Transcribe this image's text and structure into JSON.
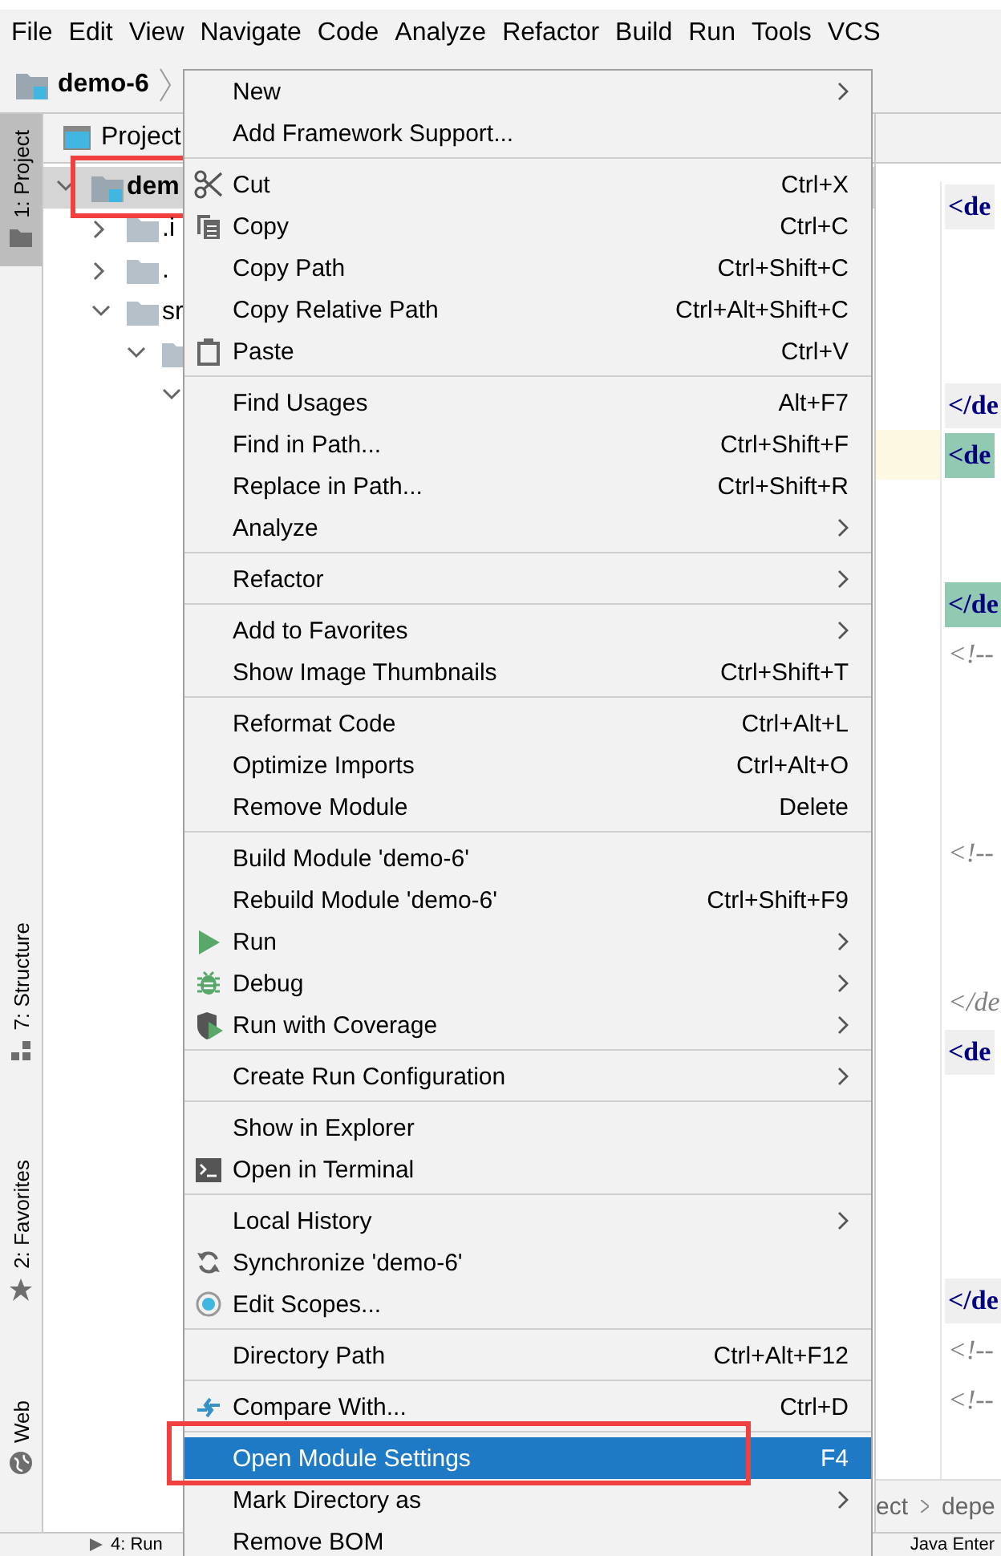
{
  "menubar": [
    "File",
    "Edit",
    "View",
    "Navigate",
    "Code",
    "Analyze",
    "Refactor",
    "Build",
    "Run",
    "Tools",
    "VCS"
  ],
  "breadcrumb": {
    "label": "demo-6"
  },
  "tool_strip": [
    {
      "label": "1: Project",
      "selected": true
    },
    {
      "label": "7: Structure",
      "selected": false
    },
    {
      "label": "2: Favorites",
      "selected": false
    },
    {
      "label": "Web",
      "selected": false
    }
  ],
  "project_panel": {
    "title": "Project",
    "tree": [
      {
        "label": "dem",
        "kind": "module",
        "expanded": true,
        "selected": true,
        "annotated": true,
        "children": [
          {
            "label": ".i",
            "kind": "folder",
            "expanded": false,
            "selected": false,
            "annotated": false
          },
          {
            "label": ".",
            "kind": "folder",
            "expanded": false,
            "selected": false,
            "annotated": false
          },
          {
            "label": "sr",
            "kind": "folder",
            "expanded": true,
            "selected": false,
            "annotated": false,
            "children": [
              {
                "kind": "folder",
                "expanded": true,
                "selected": false,
                "annotated": false,
                "children": [
                  {
                    "expanded": true,
                    "selected": false,
                    "annotated": false
                  }
                ]
              }
            ]
          }
        ]
      }
    ]
  },
  "editor": {
    "lines": [
      {
        "kind": "tag",
        "text": "<de",
        "color": "#efefef"
      },
      {
        "kind": "blank"
      },
      {
        "kind": "blank"
      },
      {
        "kind": "blank"
      },
      {
        "kind": "tag",
        "text": "</de",
        "color": "#efefef"
      },
      {
        "kind": "tag",
        "text": "<de",
        "color": "#92c9b3"
      },
      {
        "kind": "blank"
      },
      {
        "kind": "blank"
      },
      {
        "kind": "tag",
        "text": "</de",
        "color": "#92c9b3"
      },
      {
        "kind": "comment",
        "text": "<!--"
      },
      {
        "kind": "blank"
      },
      {
        "kind": "blank"
      },
      {
        "kind": "blank"
      },
      {
        "kind": "comment",
        "text": "<!--"
      },
      {
        "kind": "blank"
      },
      {
        "kind": "blank"
      },
      {
        "kind": "comment",
        "text": "</de"
      },
      {
        "kind": "tag",
        "text": "<de",
        "color": "#efefef"
      },
      {
        "kind": "blank"
      },
      {
        "kind": "blank"
      },
      {
        "kind": "blank"
      },
      {
        "kind": "blank"
      },
      {
        "kind": "tag",
        "text": "</de",
        "color": "#efefef"
      },
      {
        "kind": "comment",
        "text": "<!--"
      },
      {
        "kind": "comment",
        "text": "<!--"
      }
    ],
    "breadcrumb": [
      "ect",
      "depe"
    ]
  },
  "bottom_bar": {
    "run_tab": "4: Run",
    "right_tab": "Java Enter"
  },
  "context_menu": {
    "groups": [
      [
        {
          "label": "New",
          "submenu": true,
          "selected": false
        },
        {
          "label": "Add Framework Support...",
          "selected": false
        }
      ],
      [
        {
          "label": "Cut",
          "shortcut": "Ctrl+X",
          "kind": "scissors",
          "selected": false
        },
        {
          "label": "Copy",
          "shortcut": "Ctrl+C",
          "kind": "copy",
          "selected": false
        },
        {
          "label": "Copy Path",
          "shortcut": "Ctrl+Shift+C",
          "selected": false
        },
        {
          "label": "Copy Relative Path",
          "shortcut": "Ctrl+Alt+Shift+C",
          "selected": false
        },
        {
          "label": "Paste",
          "shortcut": "Ctrl+V",
          "kind": "clipboard",
          "selected": false
        }
      ],
      [
        {
          "label": "Find Usages",
          "shortcut": "Alt+F7",
          "selected": false
        },
        {
          "label": "Find in Path...",
          "shortcut": "Ctrl+Shift+F",
          "selected": false
        },
        {
          "label": "Replace in Path...",
          "shortcut": "Ctrl+Shift+R",
          "selected": false
        },
        {
          "label": "Analyze",
          "submenu": true,
          "selected": false
        }
      ],
      [
        {
          "label": "Refactor",
          "submenu": true,
          "selected": false
        }
      ],
      [
        {
          "label": "Add to Favorites",
          "submenu": true,
          "selected": false
        },
        {
          "label": "Show Image Thumbnails",
          "shortcut": "Ctrl+Shift+T",
          "selected": false
        }
      ],
      [
        {
          "label": "Reformat Code",
          "shortcut": "Ctrl+Alt+L",
          "selected": false
        },
        {
          "label": "Optimize Imports",
          "shortcut": "Ctrl+Alt+O",
          "selected": false
        },
        {
          "label": "Remove Module",
          "shortcut": "Delete",
          "selected": false
        }
      ],
      [
        {
          "label": "Build Module 'demo-6'",
          "selected": false
        },
        {
          "label": "Rebuild Module 'demo-6'",
          "shortcut": "Ctrl+Shift+F9",
          "selected": false
        },
        {
          "label": "Run",
          "submenu": true,
          "kind": "run",
          "selected": false
        },
        {
          "label": "Debug",
          "submenu": true,
          "kind": "bug",
          "selected": false
        },
        {
          "label": "Run with Coverage",
          "submenu": true,
          "kind": "coverage",
          "selected": false
        }
      ],
      [
        {
          "label": "Create Run Configuration",
          "submenu": true,
          "selected": false
        }
      ],
      [
        {
          "label": "Show in Explorer",
          "selected": false
        },
        {
          "label": "Open in Terminal",
          "kind": "terminal",
          "selected": false
        }
      ],
      [
        {
          "label": "Local History",
          "submenu": true,
          "selected": false
        },
        {
          "label": "Synchronize 'demo-6'",
          "kind": "sync",
          "selected": false
        },
        {
          "label": "Edit Scopes...",
          "kind": "scope",
          "selected": false
        }
      ],
      [
        {
          "label": "Directory Path",
          "shortcut": "Ctrl+Alt+F12",
          "selected": false
        }
      ],
      [
        {
          "label": "Compare With...",
          "shortcut": "Ctrl+D",
          "kind": "compare",
          "selected": false
        }
      ],
      [
        {
          "label": "Open Module Settings",
          "shortcut": "F4",
          "selected": true,
          "annotated": true
        },
        {
          "label": "Mark Directory as",
          "submenu": true,
          "selected": false
        },
        {
          "label": "Remove BOM",
          "selected": false
        }
      ]
    ]
  }
}
